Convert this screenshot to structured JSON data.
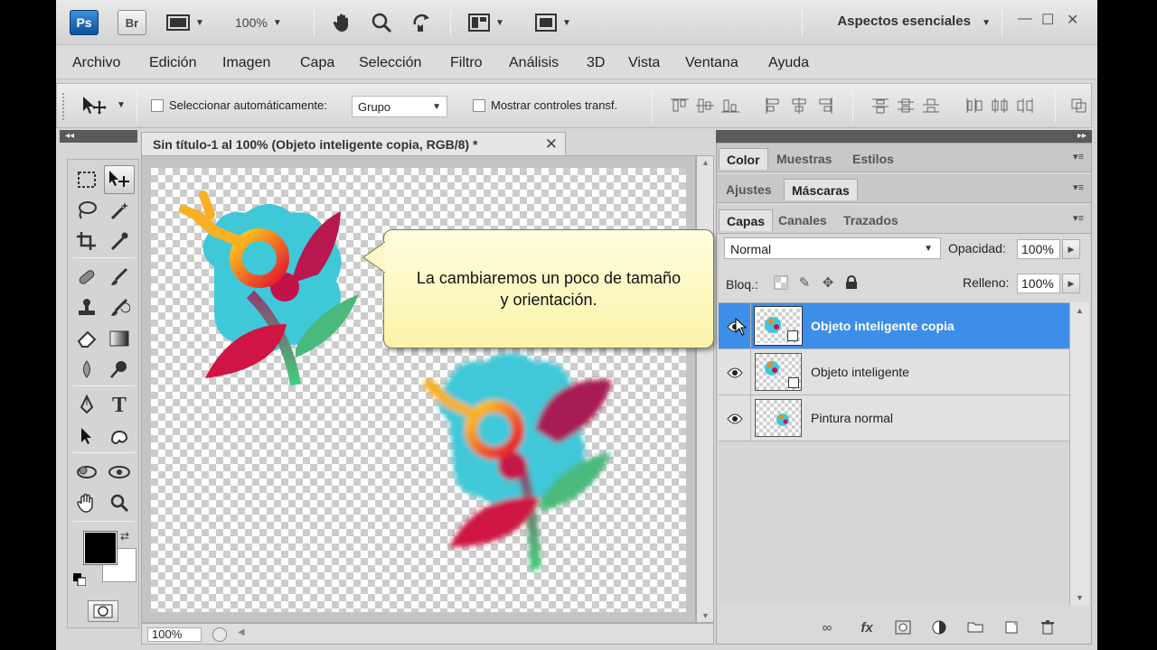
{
  "appbar": {
    "ps_logo": "Ps",
    "br_logo": "Br",
    "zoom": "100%",
    "workspace": "Aspectos esenciales"
  },
  "menu": [
    "Archivo",
    "Edición",
    "Imagen",
    "Capa",
    "Selección",
    "Filtro",
    "Análisis",
    "3D",
    "Vista",
    "Ventana",
    "Ayuda"
  ],
  "options": {
    "auto_select_label": "Seleccionar automáticamente:",
    "auto_select_value": "Grupo",
    "show_transform_label": "Mostrar controles transf."
  },
  "document": {
    "tab_title": "Sin título-1 al 100% (Objeto inteligente copia, RGB/8) *",
    "zoom_status": "100%"
  },
  "callout": {
    "line1": "La cambiaremos un poco de tamaño",
    "line2": "y orientación."
  },
  "panels": {
    "group1_tabs": [
      "Color",
      "Muestras",
      "Estilos"
    ],
    "group2_tabs": [
      "Ajustes",
      "Máscaras"
    ],
    "group3_tabs": [
      "Capas",
      "Canales",
      "Trazados"
    ],
    "blend_mode": "Normal",
    "opacity_label": "Opacidad:",
    "opacity_value": "100%",
    "lock_label": "Bloq.:",
    "fill_label": "Relleno:",
    "fill_value": "100%"
  },
  "layers": [
    {
      "name": "Objeto inteligente copia",
      "selected": true,
      "smart": true
    },
    {
      "name": "Objeto inteligente",
      "selected": false,
      "smart": true
    },
    {
      "name": "Pintura normal",
      "selected": false,
      "smart": false
    }
  ],
  "colors": {
    "foreground": "#000000",
    "background": "#ffffff",
    "selected_layer": "#3d8ee8",
    "callout_bg": "#fbf3a8",
    "flower_cyan": "#3fc8d8",
    "flower_crimson": "#c8124a",
    "flower_orange": "#f28a1a",
    "flower_green": "#4cc27a"
  },
  "icons": {
    "toolbar": [
      "hand-icon",
      "zoom-icon",
      "rotate-view-icon",
      "arrange-documents-icon",
      "screen-mode-icon"
    ],
    "tools": [
      "marquee-icon",
      "move-icon",
      "lasso-icon",
      "magic-wand-icon",
      "crop-icon",
      "eyedropper-icon",
      "healing-brush-icon",
      "brush-icon",
      "clone-stamp-icon",
      "history-brush-icon",
      "eraser-icon",
      "gradient-icon",
      "blur-icon",
      "dodge-icon",
      "pen-icon",
      "type-icon",
      "path-selection-icon",
      "custom-shape-icon",
      "3d-rotate-icon",
      "3d-orbit-icon",
      "hand-icon",
      "zoom-icon"
    ],
    "layers_footer": [
      "link-layers-icon",
      "fx-icon",
      "add-mask-icon",
      "adjustment-layer-icon",
      "new-group-icon",
      "new-layer-icon",
      "trash-icon"
    ]
  }
}
